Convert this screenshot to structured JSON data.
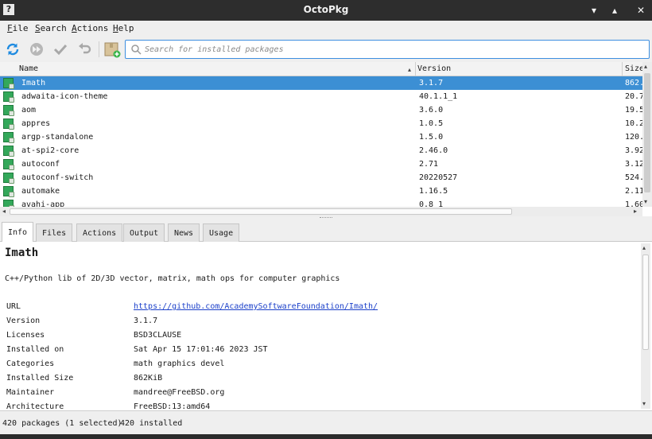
{
  "window": {
    "title": "OctoPkg",
    "help_glyph": "?",
    "minimize_glyph": "▾",
    "maximize_glyph": "▴",
    "close_glyph": "✕"
  },
  "menu": {
    "file": "File",
    "search": "Search",
    "actions": "Actions",
    "help": "Help"
  },
  "search": {
    "placeholder": "Search for installed packages"
  },
  "table": {
    "columns": {
      "name": "Name",
      "version": "Version",
      "size": "Size"
    },
    "rows": [
      {
        "name": "Imath",
        "version": "3.1.7",
        "size": "862.",
        "selected": true
      },
      {
        "name": "adwaita-icon-theme",
        "version": "40.1.1_1",
        "size": "20.7"
      },
      {
        "name": "aom",
        "version": "3.6.0",
        "size": "19.5"
      },
      {
        "name": "appres",
        "version": "1.0.5",
        "size": "10.2"
      },
      {
        "name": "argp-standalone",
        "version": "1.5.0",
        "size": "120."
      },
      {
        "name": "at-spi2-core",
        "version": "2.46.0",
        "size": "3.92"
      },
      {
        "name": "autoconf",
        "version": "2.71",
        "size": "3.12"
      },
      {
        "name": "autoconf-switch",
        "version": "20220527",
        "size": "524."
      },
      {
        "name": "automake",
        "version": "1.16.5",
        "size": "2.11"
      },
      {
        "name": "avahi-app",
        "version": "0.8_1",
        "size": "1.60"
      }
    ]
  },
  "tabs": [
    "Info",
    "Files",
    "Actions",
    "Output",
    "News",
    "Usage"
  ],
  "info": {
    "name": "Imath",
    "description": "C++/Python lib of 2D/3D vector, matrix, math ops for computer graphics",
    "fields": [
      {
        "key": "URL",
        "value": "https://github.com/AcademySoftwareFoundation/Imath/"
      },
      {
        "key": "Version",
        "value": "3.1.7"
      },
      {
        "key": "Licenses",
        "value": "BSD3CLAUSE"
      },
      {
        "key": "Installed on",
        "value": "Sat Apr 15 17:01:46 2023 JST"
      },
      {
        "key": "Categories",
        "value": "math graphics devel"
      },
      {
        "key": "Installed Size",
        "value": "862KiB"
      },
      {
        "key": "Maintainer",
        "value": "mandree@FreeBSD.org"
      },
      {
        "key": "Architecture",
        "value": "FreeBSD:13:amd64"
      }
    ]
  },
  "status": {
    "packages": "420 packages (1 selected)",
    "installed": "420 installed"
  },
  "colors": {
    "selection": "#3c8fd4",
    "link": "#1a3fc9",
    "titlebar": "#2d2d2d",
    "package_icon": "#33a85a"
  }
}
